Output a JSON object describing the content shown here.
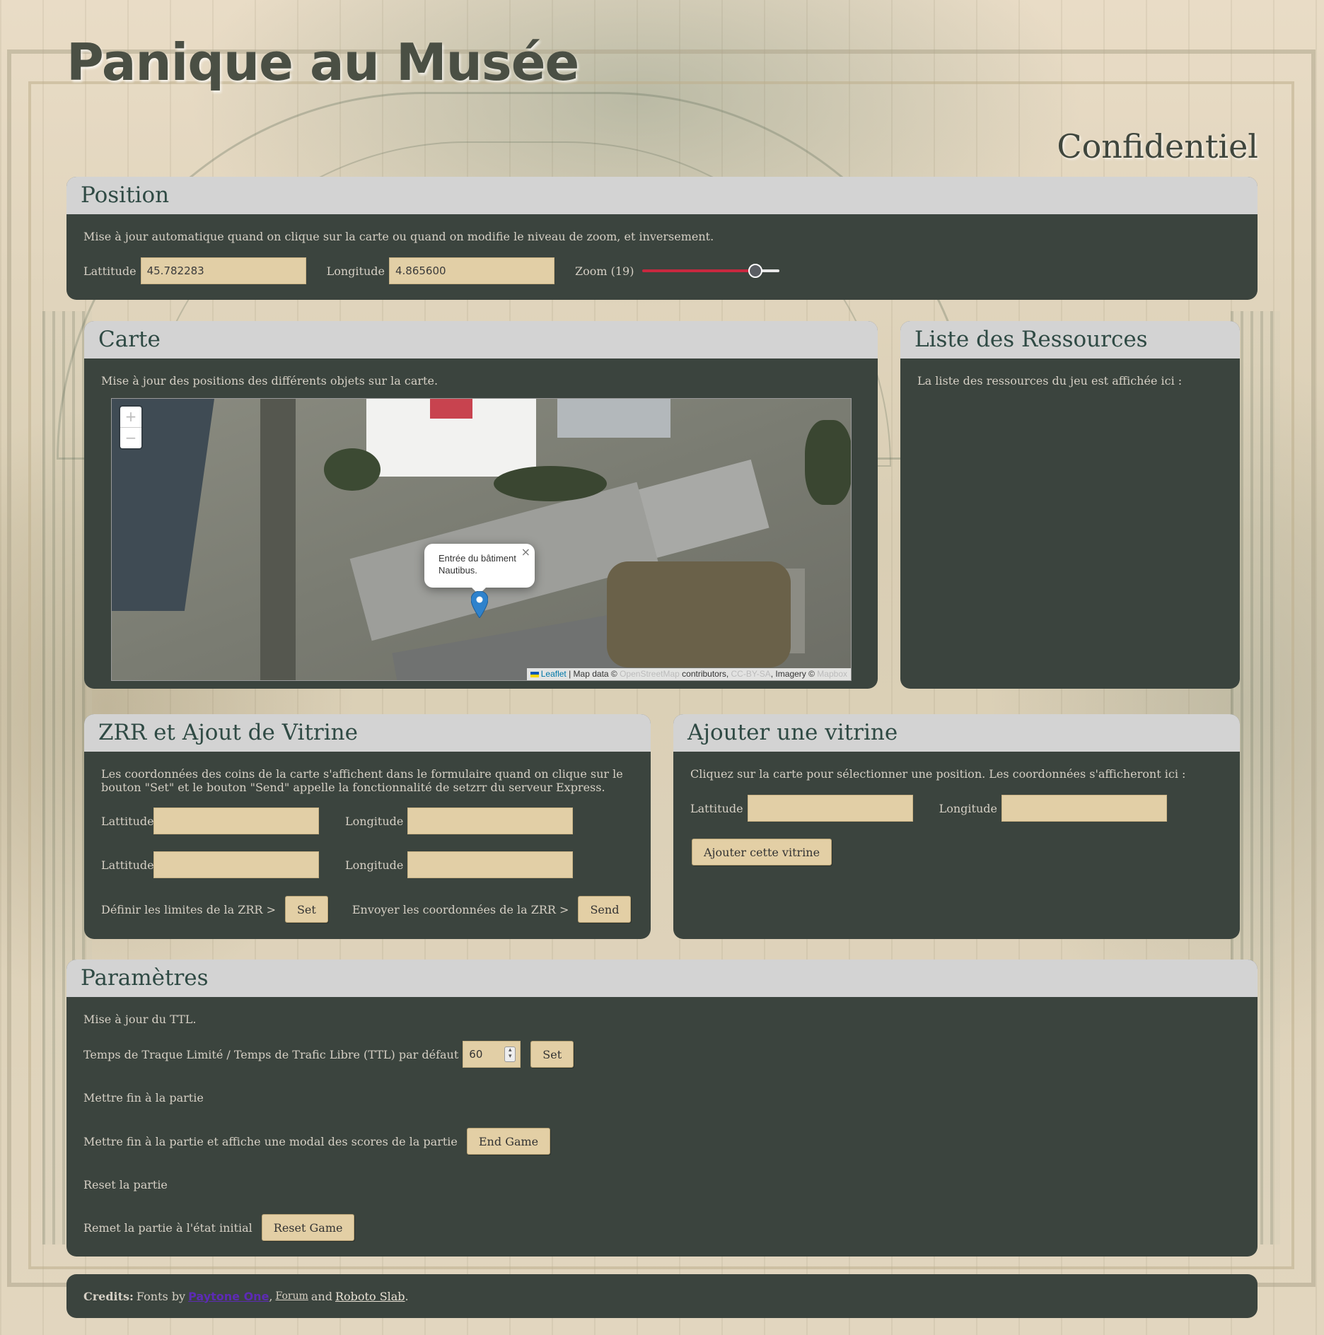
{
  "page": {
    "title": "Panique au Musée",
    "subtitle": "Confidentiel"
  },
  "position": {
    "heading": "Position",
    "description": "Mise à jour automatique quand on clique sur la carte ou quand on modifie le niveau de zoom, et inversement.",
    "lat_label": "Lattitude",
    "lat_value": "45.782283",
    "lng_label": "Longitude",
    "lng_value": "4.865600",
    "zoom_label": "Zoom (19)",
    "zoom_level": 19,
    "zoom_fraction": 0.86,
    "slider_color": "#c8283f"
  },
  "carte": {
    "heading": "Carte",
    "description": "Mise à jour des positions des différents objets sur la carte.",
    "zoom_in": "+",
    "zoom_out": "−",
    "popup_text": "Entrée du bâtiment Nautibus.",
    "popup_close": "×",
    "attribution": {
      "leaflet": "Leaflet",
      "map_data": " | Map data © ",
      "osm": "OpenStreetMap",
      "contributors": " contributors, ",
      "ccbysa": "CC-BY-SA",
      "imagery": ", Imagery © ",
      "mapbox": "Mapbox"
    }
  },
  "ressources": {
    "heading": "Liste des Ressources",
    "description": "La liste des ressources du jeu est affichée ici :"
  },
  "zrr": {
    "heading": "ZRR et Ajout de Vitrine",
    "description": "Les coordonnées des coins de la carte s'affichent dans le formulaire quand on clique sur le bouton \"Set\" et le bouton \"Send\" appelle la fonctionnalité de setzrr du serveur Express.",
    "lat1_label": "Lattitude",
    "lng1_label": "Longitude",
    "lat2_label": "Lattitude",
    "lng2_label": "Longitude",
    "set_text": "Définir les limites de la ZRR >",
    "set_button": "Set",
    "send_text": "Envoyer les coordonnées de la ZRR >",
    "send_button": "Send"
  },
  "vitrine": {
    "heading": "Ajouter une vitrine",
    "description": "Cliquez sur la carte pour sélectionner une position. Les coordonnées s'afficheront ici :",
    "lat_label": "Lattitude",
    "lng_label": "Longitude",
    "add_button": "Ajouter cette vitrine"
  },
  "parametres": {
    "heading": "Paramètres",
    "ttl_title": "Mise à jour du TTL.",
    "ttl_label": "Temps de Traque Limité / Temps de Trafic Libre (TTL) par défaut",
    "ttl_value": "60",
    "ttl_button": "Set",
    "end_title": "Mettre fin à la partie",
    "end_label": "Mettre fin à la partie et affiche une modal des scores de la partie",
    "end_button": "End Game",
    "reset_title": "Reset la partie",
    "reset_label": "Remet la partie à l'état initial",
    "reset_button": "Reset Game"
  },
  "footer": {
    "credits_label": "Credits:",
    "fonts_by": "Fonts by",
    "font1": "Paytone One",
    "sep1": ",",
    "font2": "Forum",
    "and": "and",
    "font3": "Roboto Slab",
    "end": "."
  }
}
